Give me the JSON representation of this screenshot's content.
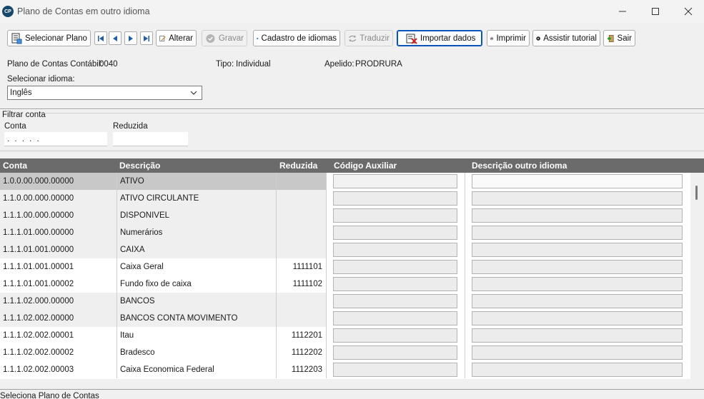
{
  "window": {
    "logo": "CP",
    "title": "Plano de Contas em outro idioma"
  },
  "toolbar": {
    "selecionar_plano": "Selecionar Plano",
    "alterar": "Alterar",
    "gravar": "Gravar",
    "cadastro_idiomas": "Cadastro de idiomas",
    "traduzir": "Traduzir",
    "importar_dados": "Importar dados",
    "imprimir": "Imprimir",
    "assistir_tutorial": "Assistir tutorial",
    "sair": "Sair"
  },
  "info": {
    "plano_label": "Plano de Contas Contábil:",
    "plano_value": "0040",
    "tipo_label": "Tipo:",
    "tipo_value": "Individual",
    "apelido_label": "Apelido:",
    "apelido_value": "PRODRURA",
    "idioma_label": "Selecionar idioma:",
    "idioma_value": "Inglês"
  },
  "filter": {
    "title": "Filtrar conta",
    "conta_label": "Conta",
    "conta_value": ". . . .   .",
    "reduzida_label": "Reduzida",
    "reduzida_value": ""
  },
  "grid": {
    "columns": [
      "Conta",
      "Descrição",
      "Reduzida",
      "Código Auxiliar",
      "Descrição outro idioma"
    ],
    "rows": [
      {
        "conta": "1.0.0.00.000.00000",
        "descricao": "ATIVO",
        "reduzida": ""
      },
      {
        "conta": "1.1.0.00.000.00000",
        "descricao": "ATIVO CIRCULANTE",
        "reduzida": ""
      },
      {
        "conta": "1.1.1.00.000.00000",
        "descricao": "DISPONIVEL",
        "reduzida": ""
      },
      {
        "conta": "1.1.1.01.000.00000",
        "descricao": "Numerários",
        "reduzida": ""
      },
      {
        "conta": "1.1.1.01.001.00000",
        "descricao": "CAIXA",
        "reduzida": ""
      },
      {
        "conta": "1.1.1.01.001.00001",
        "descricao": "Caixa Geral",
        "reduzida": "1111101"
      },
      {
        "conta": "1.1.1.01.001.00002",
        "descricao": "Fundo fixo de caixa",
        "reduzida": "1111102"
      },
      {
        "conta": "1.1.1.02.000.00000",
        "descricao": "BANCOS",
        "reduzida": ""
      },
      {
        "conta": "1.1.1.02.002.00000",
        "descricao": "BANCOS CONTA MOVIMENTO",
        "reduzida": ""
      },
      {
        "conta": "1.1.1.02.002.00001",
        "descricao": "Itau",
        "reduzida": "1112201"
      },
      {
        "conta": "1.1.1.02.002.00002",
        "descricao": "Bradesco",
        "reduzida": "1112202"
      },
      {
        "conta": "1.1.1.02.002.00003",
        "descricao": "Caixa Economica Federal",
        "reduzida": "1112203"
      }
    ]
  },
  "status": {
    "text": "Seleciona Plano de Contas"
  },
  "colors": {
    "header_bg": "#6b6b6b",
    "selected_row": "#c8c8c8",
    "shaded_row": "#efefef",
    "accent": "#0a55b8"
  }
}
